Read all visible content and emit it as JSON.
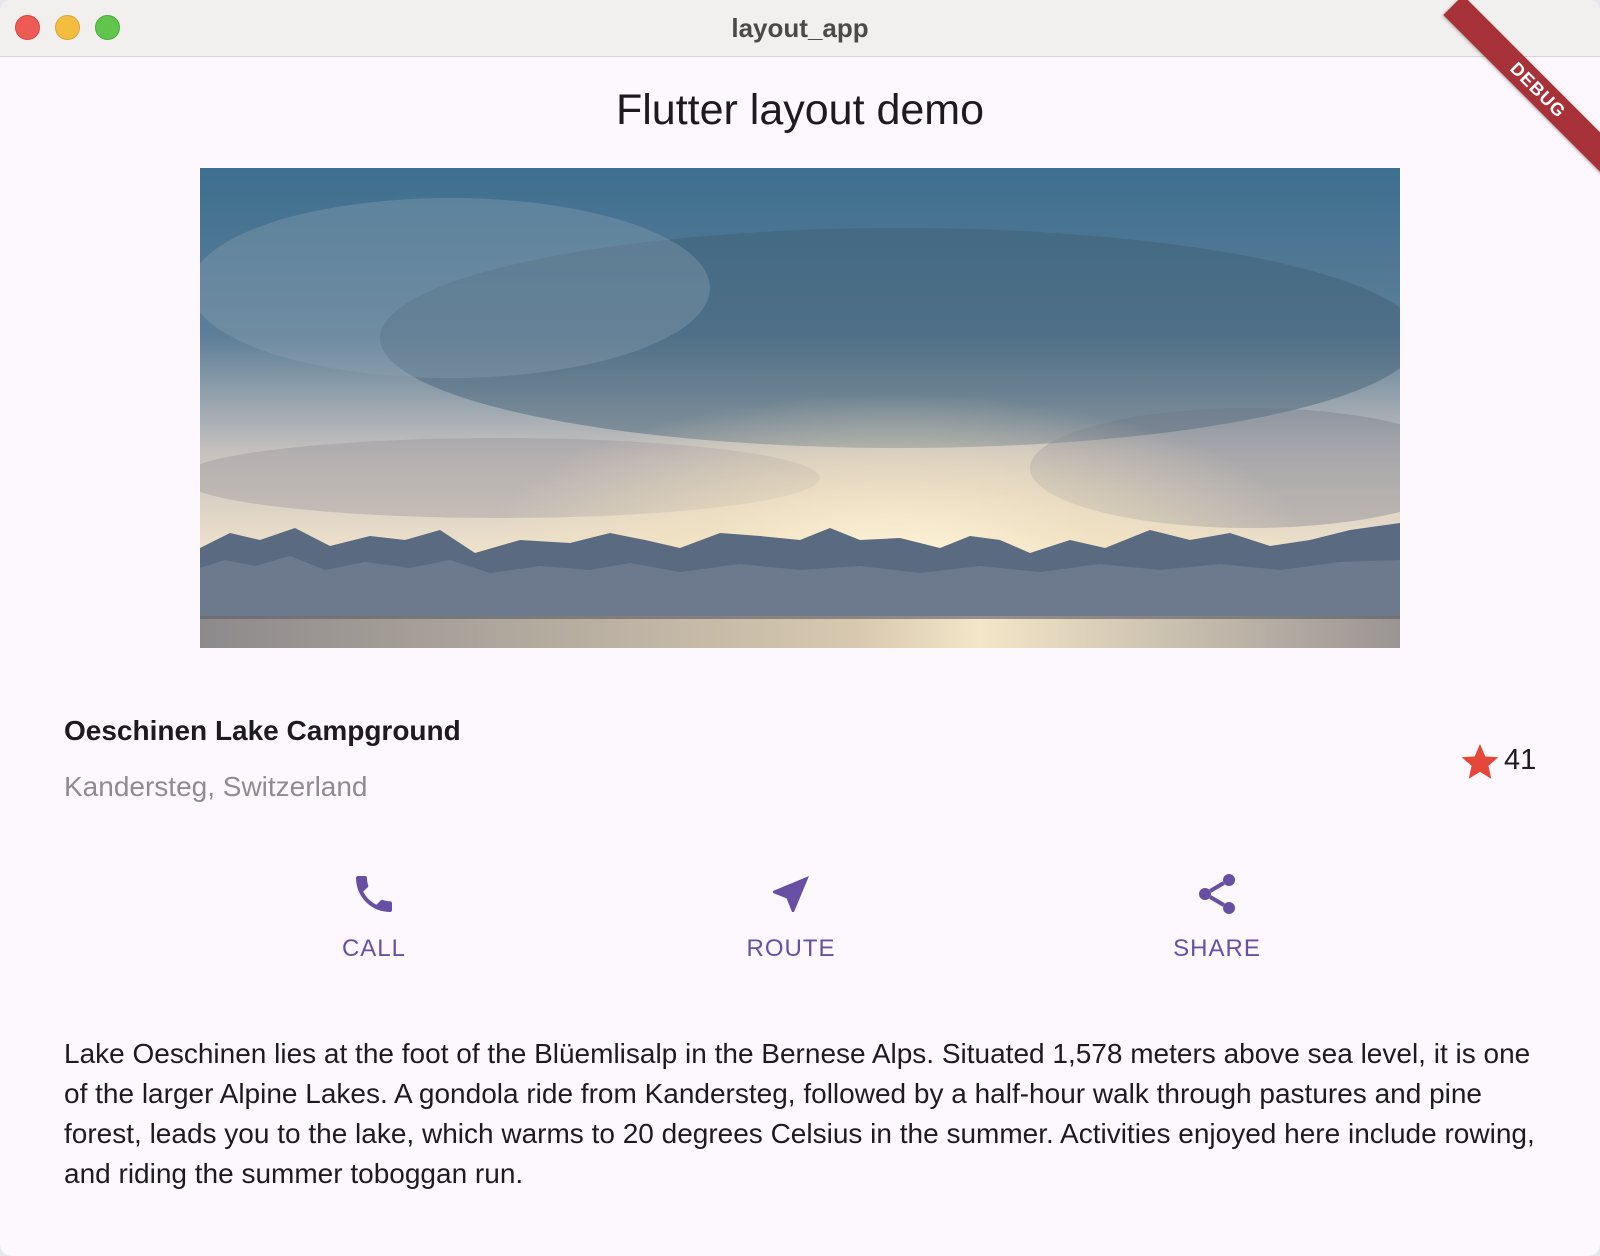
{
  "window": {
    "title": "layout_app",
    "debug_label": "DEBUG"
  },
  "app": {
    "title": "Flutter layout demo"
  },
  "place": {
    "name": "Oeschinen Lake Campground",
    "location": "Kandersteg, Switzerland",
    "favorite_count": "41",
    "star_color": "#e5483b"
  },
  "actions": [
    {
      "label": "CALL",
      "icon": "phone-icon"
    },
    {
      "label": "ROUTE",
      "icon": "navigation-icon"
    },
    {
      "label": "SHARE",
      "icon": "share-icon"
    }
  ],
  "accent_color": "#6750a4",
  "description": "Lake Oeschinen lies at the foot of the Blüemlisalp in the Bernese Alps. Situated 1,578 meters above sea level, it is one of the larger Alpine Lakes. A gondola ride from Kandersteg, followed by a half-hour walk through pastures and pine forest, leads you to the lake, which warms to 20 degrees Celsius in the summer. Activities enjoyed here include rowing, and riding the summer toboggan run."
}
